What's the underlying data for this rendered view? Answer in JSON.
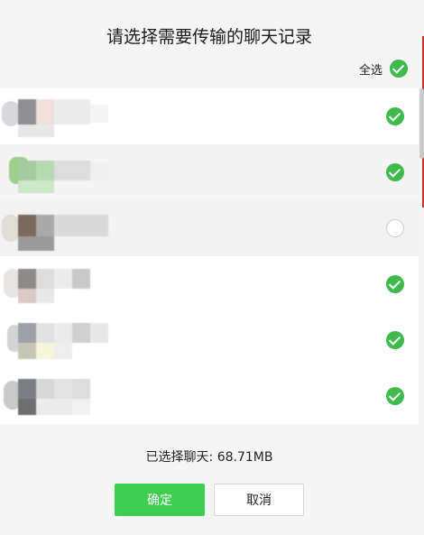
{
  "dialog": {
    "title": "请选择需要传输的聊天记录",
    "select_all_label": "全选",
    "summary": "已选择聊天: 68.71MB",
    "confirm_label": "确定",
    "cancel_label": "取消"
  },
  "chats": [
    {
      "checked": true
    },
    {
      "checked": true
    },
    {
      "checked": false
    },
    {
      "checked": true
    },
    {
      "checked": true
    },
    {
      "checked": true
    }
  ],
  "colors": {
    "accent": "#3fba4c",
    "button_green": "#3fce4f"
  }
}
